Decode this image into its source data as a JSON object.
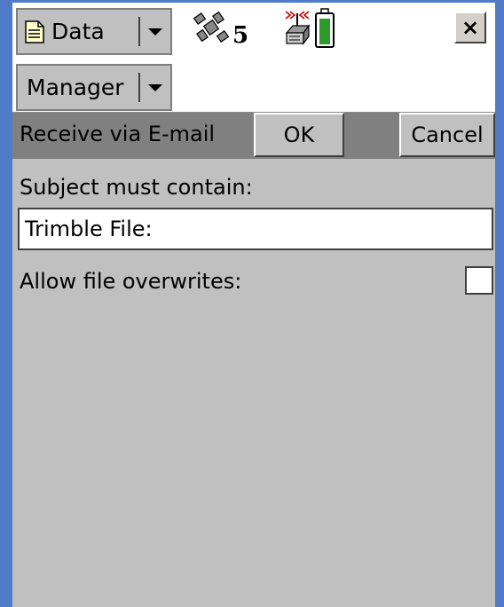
{
  "toolbar": {
    "app_menu_label": "Data",
    "satellite_count": "5",
    "close_label": "×"
  },
  "section_menu": {
    "label": "Manager"
  },
  "dialog": {
    "title": "Receive via E-mail",
    "ok_label": "OK",
    "cancel_label": "Cancel"
  },
  "form": {
    "subject_label": "Subject must contain:",
    "subject_value": "Trimble File:",
    "overwrite_label": "Allow file overwrites:",
    "overwrite_checked": false
  },
  "colors": {
    "battery": "#2e9a2e",
    "window_border": "#4f7bc9"
  },
  "icons": [
    "document-icon",
    "satellite-icon",
    "receiver-antenna-icon",
    "battery-icon",
    "chevron-down-icon"
  ]
}
